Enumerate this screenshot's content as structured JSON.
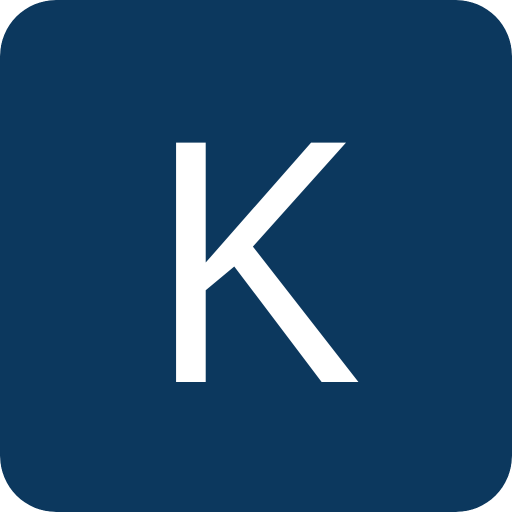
{
  "icon": {
    "letter": "K",
    "background_color": "#0c385e",
    "letter_color": "#ffffff"
  }
}
